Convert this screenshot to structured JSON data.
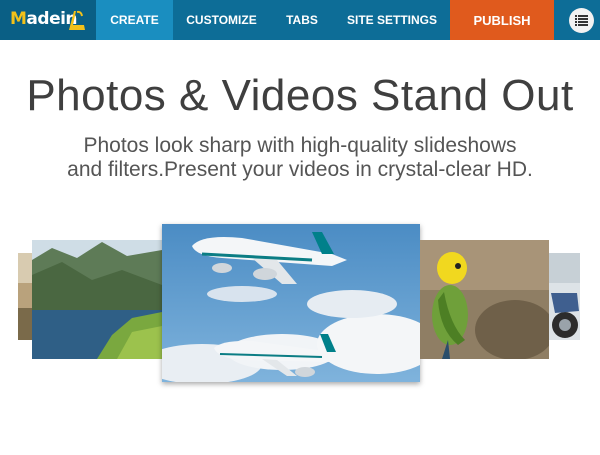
{
  "app": {
    "logo": {
      "prefix": "M",
      "rest": "adein"
    }
  },
  "nav": {
    "create": "CREATE",
    "customize": "CUSTOMIZE",
    "tabs": "TABS",
    "site_settings": "SITE SETTINGS",
    "publish": "PUBLISH",
    "menu_icon": "list-icon"
  },
  "hero": {
    "title": "Photos & Videos Stand Out",
    "subtitle_line1": "Photos look sharp with high-quality slideshows",
    "subtitle_line2": "and filters.Present your videos in crystal-clear HD."
  },
  "gallery": {
    "photos": [
      "partial-photo",
      "fjord-landscape",
      "two-airplanes",
      "parakeet",
      "motorcycle"
    ]
  },
  "colors": {
    "topbar": "#0d6d97",
    "active_tab": "#1a8ec0",
    "publish": "#e05a1d",
    "logo_accent": "#f2c11a"
  }
}
